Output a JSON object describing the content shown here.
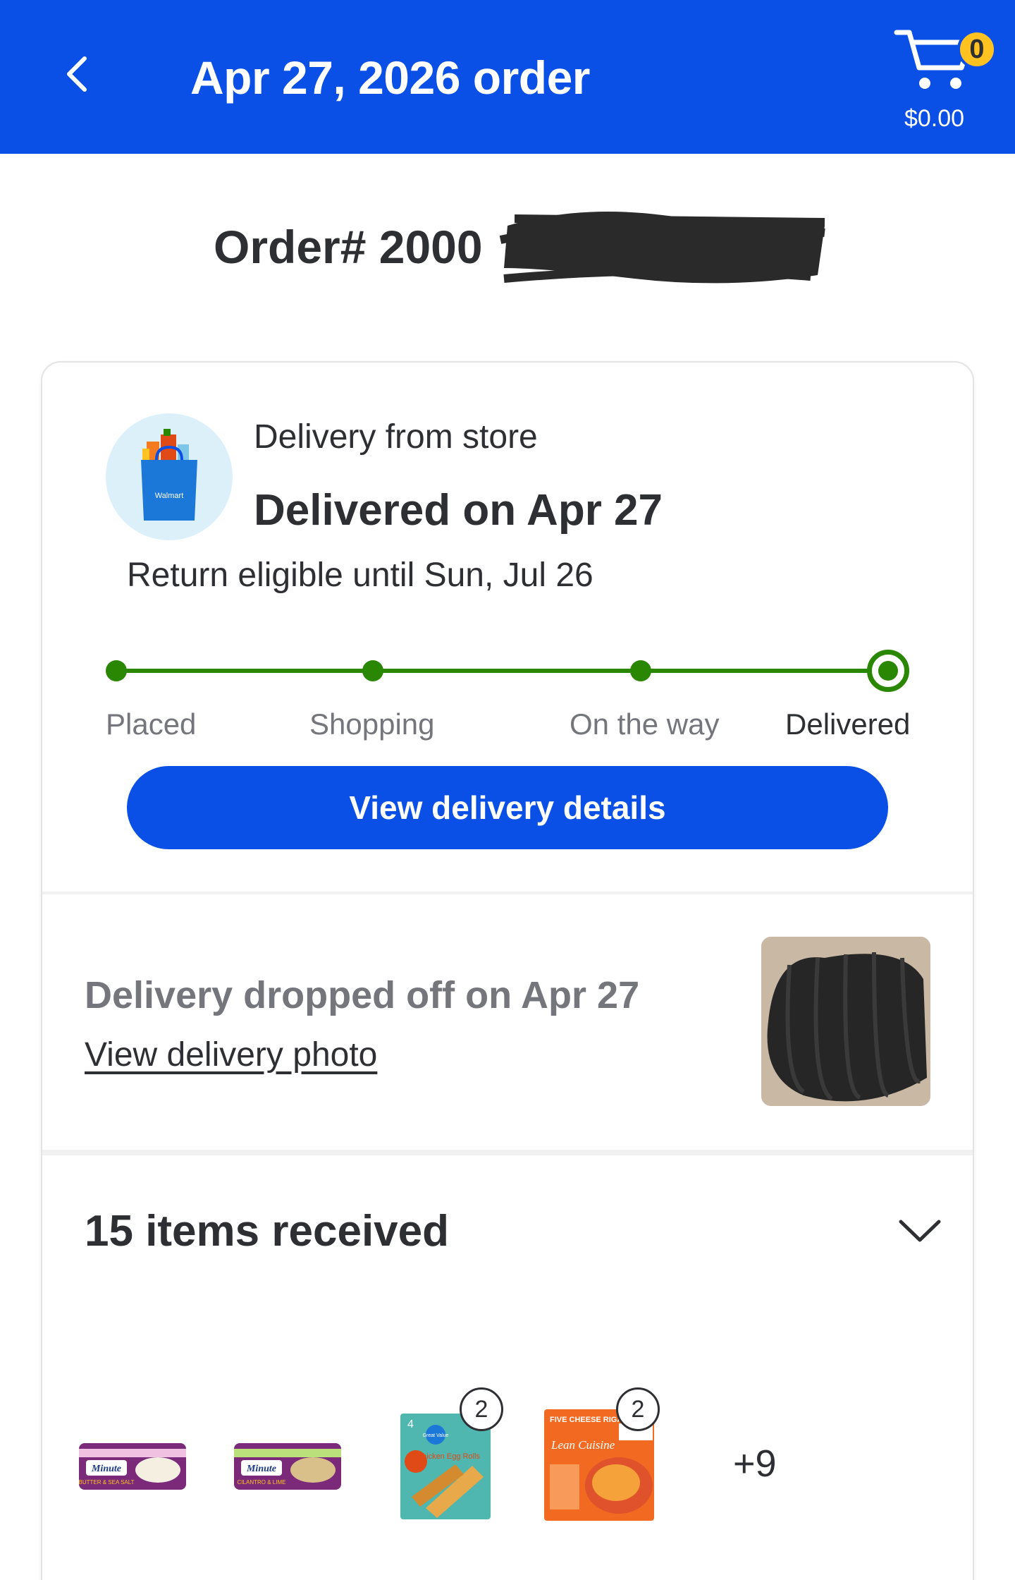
{
  "header": {
    "title": "Apr 27, 2026 order",
    "cart_count": "0",
    "cart_total": "$0.00",
    "background": "#0a50e6"
  },
  "order": {
    "number_prefix": "Order# 2000"
  },
  "delivery": {
    "type": "Delivery from store",
    "status_title": "Delivered on Apr 27",
    "return_text": "Return eligible until Sun, Jul 26",
    "bag_icon": "walmart-bag-icon",
    "bag_label": "Walmart"
  },
  "progress": {
    "steps": [
      "Placed",
      "Shopping",
      "On the way",
      "Delivered"
    ],
    "current_step": "Delivered",
    "color": "#2a8703"
  },
  "view_details_button": "View delivery details",
  "dropoff": {
    "text": "Delivery dropped off on Apr 27",
    "link": "View delivery photo"
  },
  "items": {
    "title": "15 items received",
    "thumbnails": [
      {
        "name": "Minute rice butter & sea salt",
        "brand": "Minute",
        "label": "BUTTER & SEA SALT",
        "qty": ""
      },
      {
        "name": "Minute rice cilantro & lime",
        "brand": "Minute",
        "label": "CILANTRO & LIME",
        "qty": ""
      },
      {
        "name": "Great Value chicken egg rolls",
        "count": "4",
        "brand": "Great Value",
        "label": "Chicken Egg Rolls",
        "qty": "2"
      },
      {
        "name": "Lean Cuisine five cheese rigatoni",
        "label": "FIVE CHEESE RIGATONI",
        "brand": "Lean Cuisine",
        "qty": "2"
      }
    ],
    "more": "+9"
  }
}
